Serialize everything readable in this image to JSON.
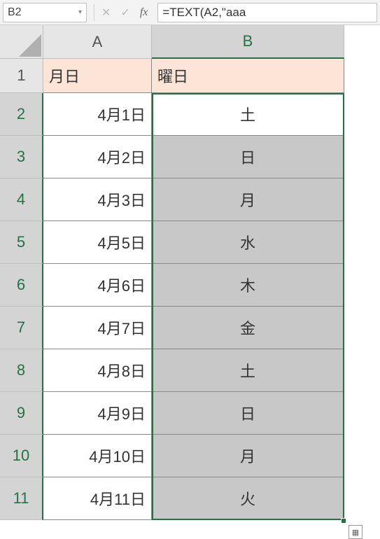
{
  "formula_bar": {
    "name_box": "B2",
    "formula": "=TEXT(A2,\"aaa"
  },
  "columns": [
    "A",
    "B"
  ],
  "rows": [
    "1",
    "2",
    "3",
    "4",
    "5",
    "6",
    "7",
    "8",
    "9",
    "10",
    "11"
  ],
  "headers": {
    "col_a": "月日",
    "col_b": "曜日"
  },
  "data": [
    {
      "date": "4月1日",
      "day": "土"
    },
    {
      "date": "4月2日",
      "day": "日"
    },
    {
      "date": "4月3日",
      "day": "月"
    },
    {
      "date": "4月5日",
      "day": "水"
    },
    {
      "date": "4月6日",
      "day": "木"
    },
    {
      "date": "4月7日",
      "day": "金"
    },
    {
      "date": "4月8日",
      "day": "土"
    },
    {
      "date": "4月9日",
      "day": "日"
    },
    {
      "date": "4月10日",
      "day": "月"
    },
    {
      "date": "4月11日",
      "day": "火"
    }
  ],
  "active_cell": "B2",
  "selection_range": "B2:B11"
}
